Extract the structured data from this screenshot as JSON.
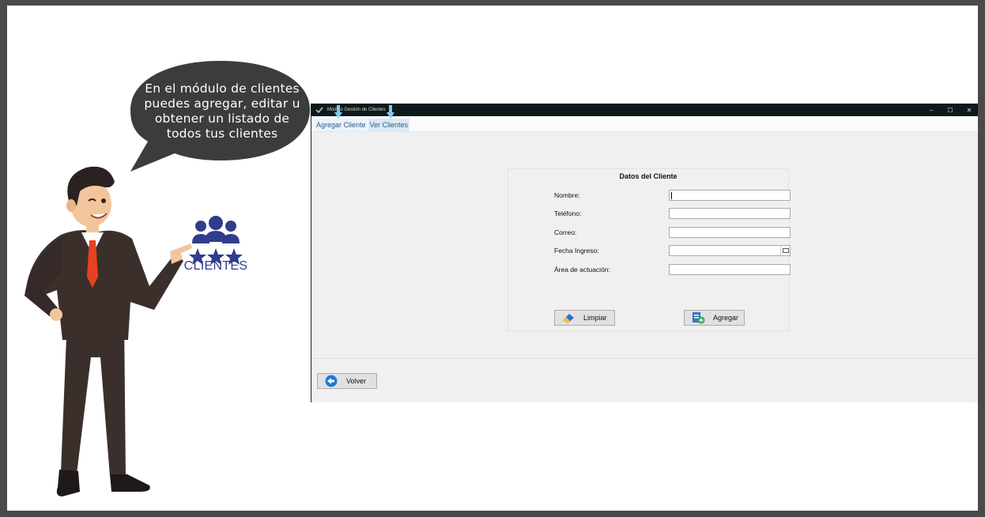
{
  "bubble": {
    "lines": [
      "En el módulo de clientes",
      "puedes agregar, editar u",
      "obtener un listado de",
      "todos tus clientes"
    ]
  },
  "clients_logo": {
    "label": "CLIENTES",
    "color": "#2f3d8c",
    "icon": "people-stars-icon"
  },
  "window": {
    "title": "Módulo Gestión de Clientes",
    "controls": {
      "minimize": "–",
      "maximize": "☐",
      "close": "✕"
    },
    "tabs": [
      "Agregar Cliente",
      "Ver Clientes"
    ],
    "form": {
      "title": "Datos del Cliente",
      "fields": [
        {
          "label": "Nombre:",
          "value": ""
        },
        {
          "label": "Teléfono:",
          "value": ""
        },
        {
          "label": "Correo:",
          "value": ""
        },
        {
          "label": "Fecha Ingreso:",
          "value": ""
        },
        {
          "label": "Área de actuación:",
          "value": ""
        }
      ],
      "clear_label": "Limpiar",
      "add_label": "Agregar"
    },
    "back_label": "Volver"
  },
  "colors": {
    "accent": "#2f3d8c",
    "titlebar": "#0d1a1c",
    "tab_arrow": "#7ec8ee"
  }
}
